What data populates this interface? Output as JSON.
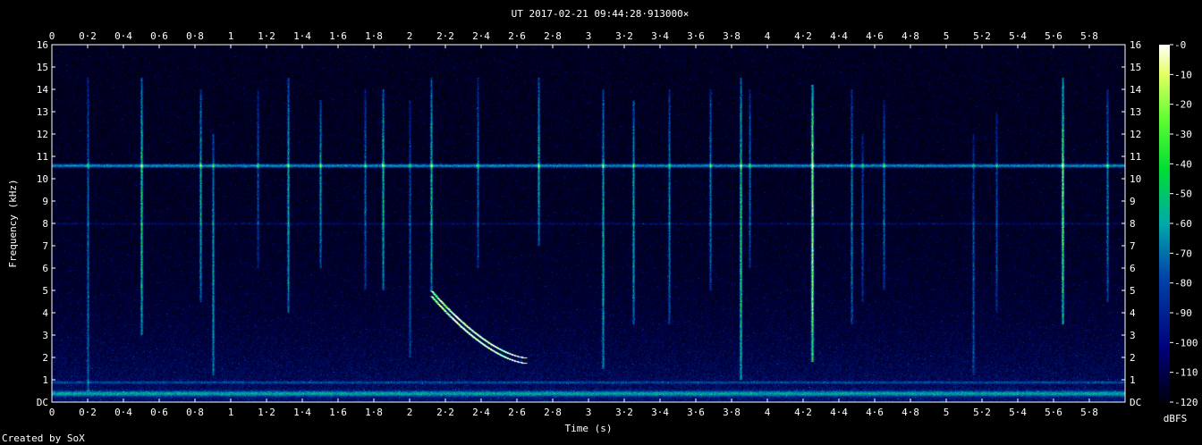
{
  "title": "UT 2017-02-21 09:44:28·913000×",
  "credit": "Created by SoX",
  "colorbar_label": "dBFS",
  "chart_data": {
    "type": "heatmap",
    "title": "UT 2017-02-21 09:44:28·913000×",
    "xlabel": "Time (s)",
    "ylabel": "Frequency (kHz)",
    "xlim": [
      0,
      6
    ],
    "ylim": [
      0,
      16
    ],
    "x_ticks": [
      "0",
      "0·2",
      "0·4",
      "0·6",
      "0·8",
      "1",
      "1·2",
      "1·4",
      "1·6",
      "1·8",
      "2",
      "2·2",
      "2·4",
      "2·6",
      "2·8",
      "3",
      "3·2",
      "3·4",
      "3·6",
      "3·8",
      "4",
      "4·2",
      "4·4",
      "4·6",
      "4·8",
      "5",
      "5·2",
      "5·4",
      "5·6",
      "5·8"
    ],
    "y_ticks": [
      "DC",
      "1",
      "2",
      "3",
      "4",
      "5",
      "6",
      "7",
      "8",
      "9",
      "10",
      "11",
      "12",
      "13",
      "14",
      "15",
      "16"
    ],
    "colorbar": {
      "label": "dBFS",
      "ticks": [
        "-0",
        "-10",
        "-20",
        "-30",
        "-40",
        "-50",
        "-60",
        "-70",
        "-80",
        "-90",
        "-100",
        "-110",
        "-120"
      ],
      "range": [
        -120,
        0
      ]
    },
    "features": {
      "horizontal_lines_khz": [
        10.6,
        8.0,
        0.4
      ],
      "impulses": [
        {
          "t": 0.2,
          "fmin": 0.5,
          "fmax": 14.5,
          "level": 0.35
        },
        {
          "t": 0.5,
          "fmin": 3.0,
          "fmax": 14.5,
          "level": 0.6
        },
        {
          "t": 0.83,
          "fmin": 4.5,
          "fmax": 14.0,
          "level": 0.5
        },
        {
          "t": 0.9,
          "fmin": 1.2,
          "fmax": 12.0,
          "level": 0.45
        },
        {
          "t": 1.15,
          "fmin": 6.0,
          "fmax": 14.0,
          "level": 0.3
        },
        {
          "t": 1.32,
          "fmin": 4.0,
          "fmax": 14.5,
          "level": 0.5
        },
        {
          "t": 1.5,
          "fmin": 6.0,
          "fmax": 13.5,
          "level": 0.45
        },
        {
          "t": 1.75,
          "fmin": 5.0,
          "fmax": 14.0,
          "level": 0.35
        },
        {
          "t": 1.85,
          "fmin": 5.0,
          "fmax": 14.0,
          "level": 0.55
        },
        {
          "t": 2.0,
          "fmin": 2.0,
          "fmax": 13.5,
          "level": 0.3
        },
        {
          "t": 2.12,
          "fmin": 5.0,
          "fmax": 14.5,
          "level": 0.55
        },
        {
          "t": 2.38,
          "fmin": 6.0,
          "fmax": 14.5,
          "level": 0.35
        },
        {
          "t": 2.72,
          "fmin": 7.0,
          "fmax": 14.5,
          "level": 0.5
        },
        {
          "t": 3.08,
          "fmin": 1.5,
          "fmax": 14.0,
          "level": 0.5
        },
        {
          "t": 3.25,
          "fmin": 3.5,
          "fmax": 13.5,
          "level": 0.5
        },
        {
          "t": 3.45,
          "fmin": 3.5,
          "fmax": 14.0,
          "level": 0.4
        },
        {
          "t": 3.68,
          "fmin": 5.0,
          "fmax": 14.0,
          "level": 0.4
        },
        {
          "t": 3.85,
          "fmin": 1.0,
          "fmax": 14.5,
          "level": 0.6
        },
        {
          "t": 3.9,
          "fmin": 6.0,
          "fmax": 14.0,
          "level": 0.35
        },
        {
          "t": 4.25,
          "fmin": 1.8,
          "fmax": 14.2,
          "level": 0.9
        },
        {
          "t": 4.47,
          "fmin": 3.5,
          "fmax": 14.0,
          "level": 0.4
        },
        {
          "t": 4.53,
          "fmin": 4.5,
          "fmax": 12.0,
          "level": 0.3
        },
        {
          "t": 4.65,
          "fmin": 5.0,
          "fmax": 13.5,
          "level": 0.35
        },
        {
          "t": 5.15,
          "fmin": 1.2,
          "fmax": 12.0,
          "level": 0.3
        },
        {
          "t": 5.28,
          "fmin": 4.0,
          "fmax": 13.0,
          "level": 0.3
        },
        {
          "t": 5.65,
          "fmin": 3.5,
          "fmax": 14.5,
          "level": 0.75
        },
        {
          "t": 5.9,
          "fmin": 4.5,
          "fmax": 14.0,
          "level": 0.4
        }
      ],
      "sweep": {
        "t_start": 2.12,
        "t_end": 2.65,
        "f_start_khz": 5.0,
        "f_end_khz": 2.0
      }
    }
  }
}
